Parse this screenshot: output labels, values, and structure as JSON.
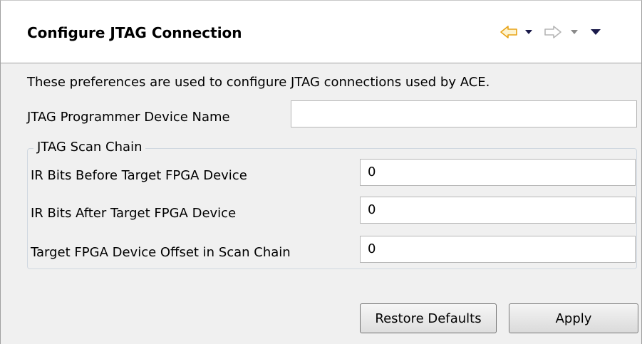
{
  "header": {
    "title": "Configure JTAG Connection",
    "nav_icons": {
      "back": "back-arrow-icon",
      "back_menu": "chevron-down-icon",
      "forward": "forward-arrow-icon",
      "forward_menu": "chevron-down-icon",
      "view_menu": "view-menu-icon"
    }
  },
  "content": {
    "description": "These preferences are used to configure JTAG connections used by ACE.",
    "programmer_label": "JTAG Programmer Device Name",
    "programmer_value": "",
    "scan_chain": {
      "legend": "JTAG Scan Chain",
      "ir_before_label": "IR Bits Before Target FPGA Device",
      "ir_before_value": "0",
      "ir_after_label": "IR Bits After Target FPGA Device",
      "ir_after_value": "0",
      "offset_label": "Target FPGA Device Offset in Scan Chain",
      "offset_value": "0"
    }
  },
  "buttons": {
    "restore_defaults": "Restore Defaults",
    "apply": "Apply"
  },
  "colors": {
    "back_arrow": "#e8a317",
    "disabled_arrow": "#b5b5b5",
    "menu_active": "#1a1a4a",
    "menu_inactive": "#8a8a8a"
  }
}
